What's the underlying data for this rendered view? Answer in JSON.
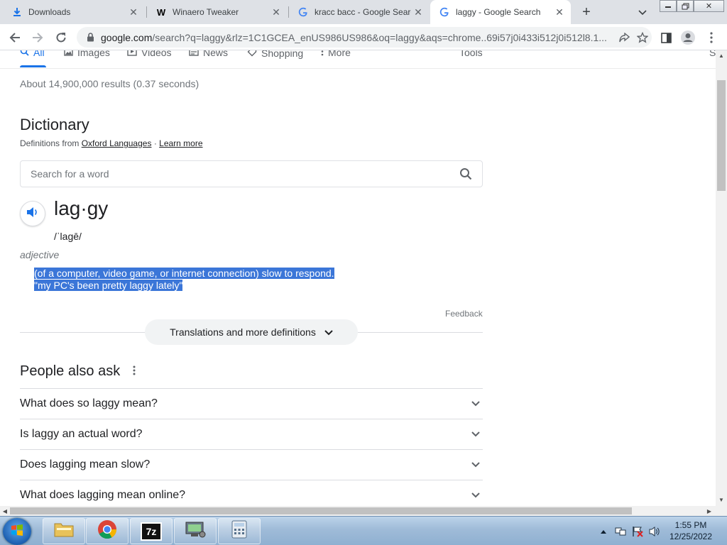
{
  "browser": {
    "tabs": [
      {
        "title": "Downloads",
        "icon": "download-icon",
        "active": false
      },
      {
        "title": "Winaero Tweaker",
        "icon": "winaero-icon",
        "favicon_text": "W",
        "active": false
      },
      {
        "title": "kracc bacc - Google Search",
        "icon": "google-icon",
        "favicon_text": "G",
        "active": false
      },
      {
        "title": "laggy - Google Search",
        "icon": "google-icon",
        "favicon_text": "G",
        "active": true
      }
    ],
    "new_tab_symbol": "+",
    "url_host": "google.com",
    "url_rest": "/search?q=laggy&rlz=1C1GCEA_enUS986US986&oq=laggy&aqs=chrome..69i57j0i433i512j0i512l8.1..."
  },
  "search_nav": {
    "items": [
      "All",
      "Images",
      "Videos",
      "News",
      "Shopping",
      "More"
    ],
    "tools": "Tools",
    "right_cut": "S"
  },
  "results": {
    "stats": "About 14,900,000 results (0.37 seconds)"
  },
  "dictionary": {
    "title": "Dictionary",
    "source_prefix": "Definitions from",
    "source_link": "Oxford Languages",
    "separator": "·",
    "learn_more": "Learn more",
    "search_placeholder": "Search for a word",
    "headword": "lag·gy",
    "phonetic": "/ˈlagē/",
    "part_of_speech": "adjective",
    "definition": "(of a computer, video game, or internet connection) slow to respond.",
    "example": "\"my PC's been pretty laggy lately\"",
    "feedback": "Feedback",
    "translations_button": "Translations and more definitions"
  },
  "people_also_ask": {
    "title": "People also ask",
    "questions": [
      "What does so laggy mean?",
      "Is laggy an actual word?",
      "Does lagging mean slow?",
      "What does lagging mean online?"
    ]
  },
  "taskbar": {
    "apps": [
      "explorer",
      "chrome",
      "7zip",
      "device-manager",
      "calculator"
    ],
    "app_label_7zip": "7z",
    "time": "1:55 PM",
    "date": "12/25/2022"
  },
  "colors": {
    "link_blue": "#1a73e8",
    "selection": "#3b76d8",
    "tab_strip": "#dee1e6"
  }
}
